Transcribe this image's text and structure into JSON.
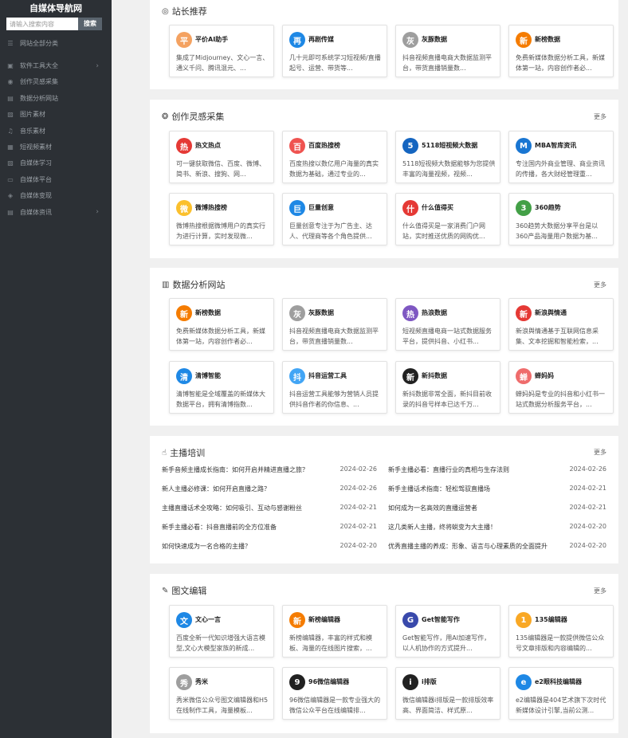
{
  "sidebar": {
    "title": "自媒体导航网",
    "search_placeholder": "请输入搜索内容",
    "search_button": "搜索",
    "items": [
      {
        "label": "网站全部分类",
        "icon": "list-icon",
        "chevron": false
      },
      {
        "label": "软件工具大全",
        "icon": "folder-icon",
        "chevron": true
      },
      {
        "label": "创作灵感采集",
        "icon": "bulb-icon",
        "chevron": false
      },
      {
        "label": "数据分析网站",
        "icon": "chart-icon",
        "chevron": false
      },
      {
        "label": "图片素材",
        "icon": "image-icon",
        "chevron": false
      },
      {
        "label": "音乐素材",
        "icon": "music-icon",
        "chevron": false
      },
      {
        "label": "短视频素材",
        "icon": "video-icon",
        "chevron": false
      },
      {
        "label": "自媒体学习",
        "icon": "book-icon",
        "chevron": false
      },
      {
        "label": "自媒体平台",
        "icon": "monitor-icon",
        "chevron": false
      },
      {
        "label": "自媒体变现",
        "icon": "location-icon",
        "chevron": false
      },
      {
        "label": "自媒体资讯",
        "icon": "news-icon",
        "chevron": true
      }
    ]
  },
  "sections": {
    "recommend": {
      "title": "站长推荐",
      "icon": "target-icon",
      "cards": [
        {
          "name": "平价AI助手",
          "desc": "集成了Midjourney、文心一言、通义千问、腾讯混元、...",
          "logo": "ai-assistant-logo",
          "color": "#f4a261"
        },
        {
          "name": "再剧传媒",
          "desc": "几十元即可系统学习短视频/直播起号、运营、带货等...",
          "logo": "zaiju-logo",
          "color": "#1e88e5"
        },
        {
          "name": "灰豚数据",
          "desc": "抖音视频直播电商大数据监测平台，带货直播销量数...",
          "logo": "huitun-logo",
          "color": "#9e9e9e"
        },
        {
          "name": "新榜数据",
          "desc": "免费新媒体数据分析工具，新媒体第一站，内容创作者必...",
          "logo": "newrank-logo",
          "color": "#f57c00"
        }
      ]
    },
    "inspiration": {
      "title": "创作灵感采集",
      "icon": "globe-icon",
      "more": "更多",
      "cards": [
        {
          "name": "热文热点",
          "desc": "可一键获取微信、百度、微博、简书、新浪、搜狗、网...",
          "logo": "rewen-logo",
          "color": "#e53935"
        },
        {
          "name": "百度热搜榜",
          "desc": "百度热搜以数亿用户海量的真实数据为基础，通过专业的...",
          "logo": "baidu-hot-logo",
          "color": "#ef5350"
        },
        {
          "name": "5118短视频大数据",
          "desc": "5118短视频大数据能够为您提供丰富的海量视频，视频...",
          "logo": "5118-logo",
          "color": "#1565c0"
        },
        {
          "name": "MBA智库资讯",
          "desc": "专注国内外商业管理、商业资讯的传播，各大财经管理重...",
          "logo": "mba-logo",
          "color": "#1976d2"
        },
        {
          "name": "微博热搜榜",
          "desc": "微博热搜根据微博用户的真实行为进行计算，实时发现微...",
          "logo": "weibo-hot-logo",
          "color": "#fbc02d"
        },
        {
          "name": "巨量创意",
          "desc": "巨量创意专注于为广告主、达人、代理商等各个角色提供...",
          "logo": "juliang-logo",
          "color": "#1e88e5"
        },
        {
          "name": "什么值得买",
          "desc": "什么值得买是一家消费门户网站，实时推送优质的网购优...",
          "logo": "smzdm-logo",
          "color": "#e53935"
        },
        {
          "name": "360趋势",
          "desc": "360趋势大数据分享平台是以360产品海量用户数据为基...",
          "logo": "360-logo",
          "color": "#43a047"
        }
      ]
    },
    "analytics": {
      "title": "数据分析网站",
      "icon": "bar-chart-icon",
      "more": "更多",
      "cards": [
        {
          "name": "新榜数据",
          "desc": "免费新媒体数据分析工具，新媒体第一站，内容创作者必...",
          "logo": "newrank-logo",
          "color": "#f57c00"
        },
        {
          "name": "灰豚数据",
          "desc": "抖音视频直播电商大数据监测平台，带货直播销量数...",
          "logo": "huitun-logo",
          "color": "#9e9e9e"
        },
        {
          "name": "热浪数据",
          "desc": "短视频直播电商一站式数据服务平台，提供抖音、小红书...",
          "logo": "relang-logo",
          "color": "#7e57c2"
        },
        {
          "name": "新浪舆情通",
          "desc": "新浪舆情通基于互联网信息采集、文本挖掘和智能检索，...",
          "logo": "sina-logo",
          "color": "#e53935"
        },
        {
          "name": "清博智能",
          "desc": "清博智能是全域覆盖的新媒体大数据平台，拥有清博指数...",
          "logo": "qingbo-logo",
          "color": "#1e88e5"
        },
        {
          "name": "抖音运营工具",
          "desc": "抖音运营工具能够为营销人员提供抖音作者的你信息、...",
          "logo": "douyin-tool-logo",
          "color": "#42a5f5"
        },
        {
          "name": "新抖数据",
          "desc": "新抖数据非常全面，新抖目前收录的抖音号样本已达千万...",
          "logo": "xindou-logo",
          "color": "#212121"
        },
        {
          "name": "蝉妈妈",
          "desc": "蝉妈妈是专业的抖音和小红书一站式数据分析服务平台，...",
          "logo": "chanmama-logo",
          "color": "#ef6c6c"
        }
      ]
    },
    "training": {
      "title": "主播培训",
      "icon": "hand-icon",
      "more": "更多",
      "articles": [
        {
          "title": "新手音频主播成长指南：如何开启并精进直播之旅？",
          "date": "2024-02-26"
        },
        {
          "title": "新手主播必看：直播行业的真相与生存法则",
          "date": "2024-02-26"
        },
        {
          "title": "新人主播必修课：如何开启直播之路？",
          "date": "2024-02-26"
        },
        {
          "title": "新手主播话术指南：轻松驾驭直播场",
          "date": "2024-02-21"
        },
        {
          "title": "主播直播话术全攻略：如何吸引、互动与感谢粉丝",
          "date": "2024-02-21"
        },
        {
          "title": "如何成为一名高效的直播运营者",
          "date": "2024-02-21"
        },
        {
          "title": "新手主播必看：抖音直播前的全方位准备",
          "date": "2024-02-21"
        },
        {
          "title": "这几类新人主播，终将蜕变为大主播！",
          "date": "2024-02-20"
        },
        {
          "title": "如何快速成为一名合格的主播？",
          "date": "2024-02-20"
        },
        {
          "title": "优秀直播主播的养成：形象、语言与心理素质的全面提升",
          "date": "2024-02-20"
        }
      ]
    },
    "editor": {
      "title": "图文编辑",
      "icon": "edit-icon",
      "more": "更多",
      "cards": [
        {
          "name": "文心一言",
          "desc": "百度全新一代知识增强大语言模型,文心大模型家族的新成...",
          "logo": "wenxin-logo",
          "color": "#1e88e5"
        },
        {
          "name": "新榜编辑器",
          "desc": "新榜编辑器，丰富的样式和模板、海量的在线图片搜索，...",
          "logo": "newrank-editor-logo",
          "color": "#f57c00"
        },
        {
          "name": "Get智能写作",
          "desc": "Get智能写作，用AI加速写作，以人机协作的方式提升...",
          "logo": "get-writing-logo",
          "color": "#3949ab"
        },
        {
          "name": "135编辑器",
          "desc": "135编辑器是一款提供微信公众号文章排版和内容编辑的...",
          "logo": "135-logo",
          "color": "#f9a825"
        },
        {
          "name": "秀米",
          "desc": "秀米微信公众号图文编辑器和H5在线制作工具，海量模板...",
          "logo": "xiumi-logo",
          "color": "#9e9e9e"
        },
        {
          "name": "96微信编辑器",
          "desc": "96微信编辑器是一款专业强大的微信公众平台在线编辑排...",
          "logo": "96-logo",
          "color": "#212121"
        },
        {
          "name": "i排版",
          "desc": "微信编辑器i排版是一款排版效率高、界面简洁、样式原...",
          "logo": "ipaiban-logo",
          "color": "#212121"
        },
        {
          "name": "e2眼科技编辑器",
          "desc": "e2编辑器是404艺术旗下次时代新媒体设计引擎,当前公测...",
          "logo": "e2-logo",
          "color": "#1e88e5"
        }
      ]
    }
  }
}
